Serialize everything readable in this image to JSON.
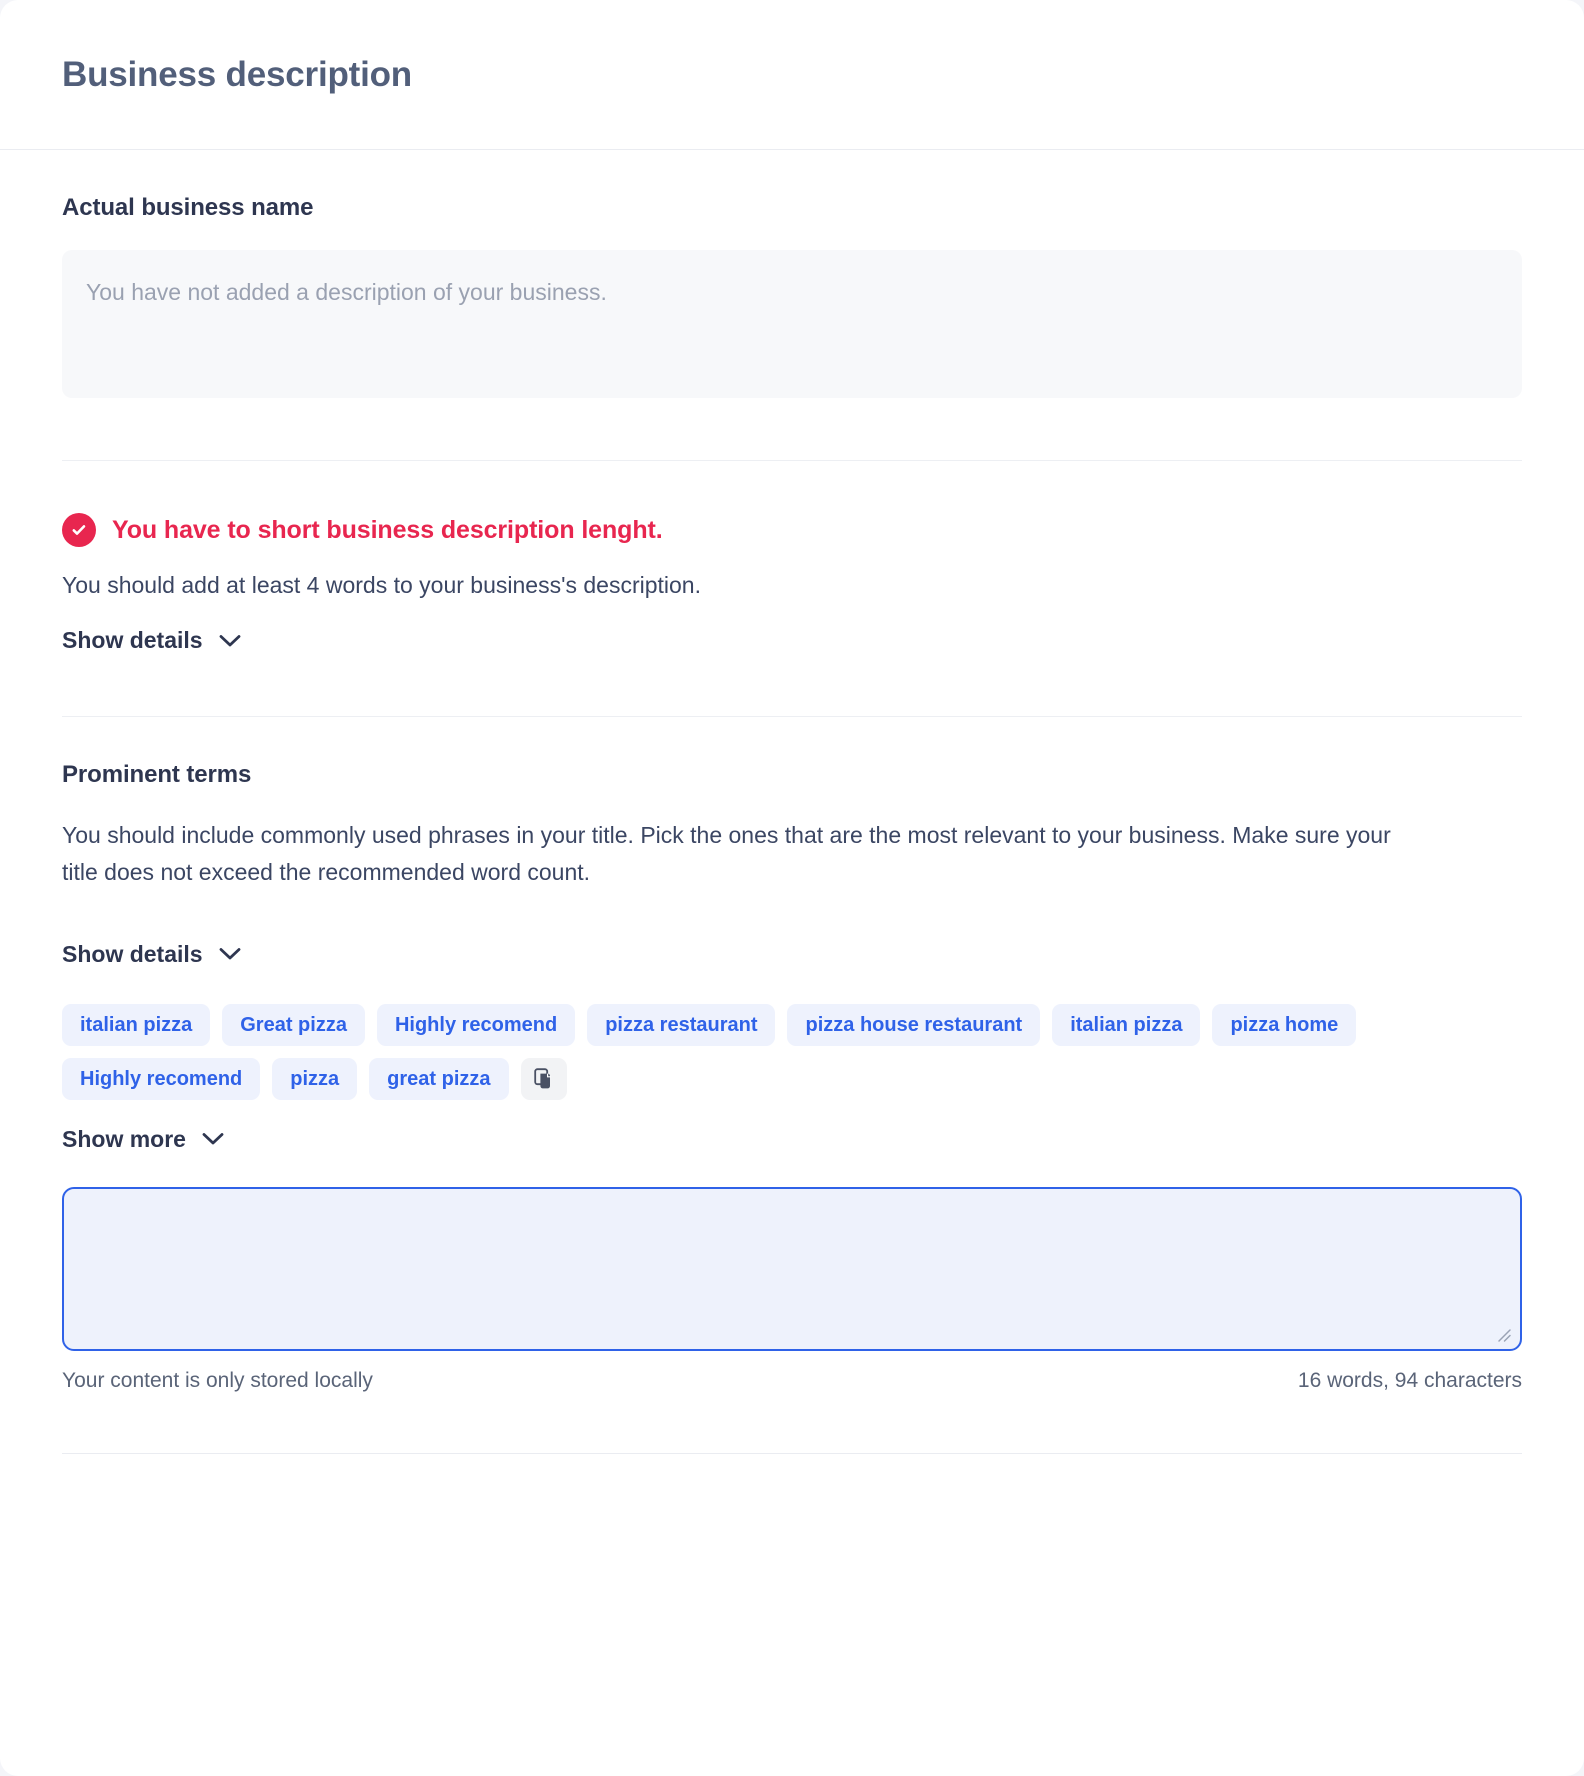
{
  "header": {
    "title": "Business description"
  },
  "business_name_section": {
    "heading": "Actual business name",
    "readonly_value": "You have not added a description of your business."
  },
  "alert": {
    "icon": "check-circle-icon",
    "title": "You have to short business description lenght.",
    "description": "You should add at least 4 words to your business's description.",
    "toggle_label": "Show details",
    "toggle_icon": "chevron-down-icon",
    "accent_color": "#e8264f"
  },
  "prominent_terms": {
    "heading": "Prominent terms",
    "description": "You should include commonly used phrases in your title. Pick the ones that are the most relevant to your business. Make sure your title does not exceed the recommended word count.",
    "toggle_label": "Show details",
    "toggle_icon": "chevron-down-icon",
    "tags": [
      "italian pizza",
      "Great pizza",
      "Highly recomend",
      "pizza restaurant",
      "pizza house restaurant",
      "italian pizza",
      "pizza home",
      "Highly recomend",
      "pizza",
      "great pizza"
    ],
    "copy_button_icon": "copy-icon",
    "show_more_label": "Show more",
    "show_more_icon": "chevron-down-icon",
    "tag_bg_color": "#eef2fd",
    "tag_text_color": "#2f62e8"
  },
  "notes_editor": {
    "value": "",
    "placeholder": "",
    "border_color": "#2f62e8",
    "background_color": "#eef2fc",
    "storage_note": "Your content is only stored locally",
    "counter": "16 words, 94 characters"
  }
}
